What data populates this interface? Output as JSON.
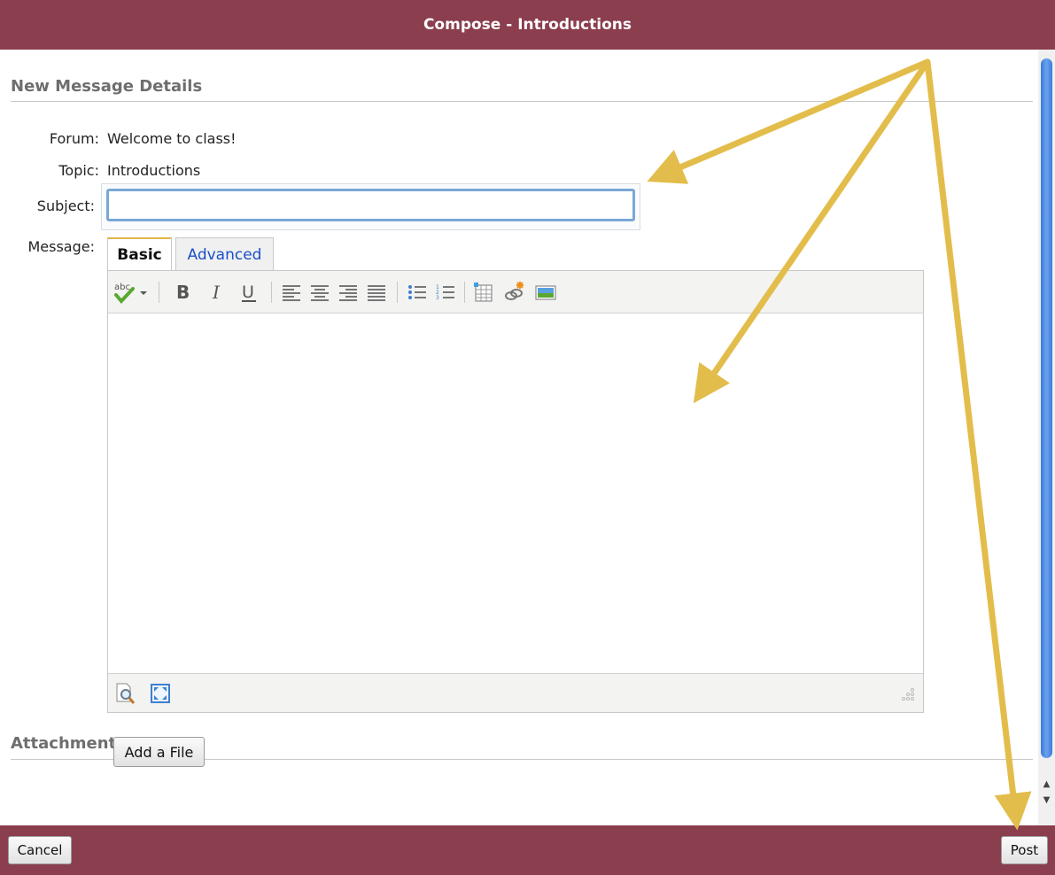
{
  "window": {
    "title": "Compose - Introductions"
  },
  "details": {
    "heading": "New Message Details",
    "forum_label": "Forum:",
    "forum_value": "Welcome to class!",
    "topic_label": "Topic:",
    "topic_value": "Introductions",
    "subject_label": "Subject:",
    "subject_value": "",
    "message_label": "Message:"
  },
  "editor": {
    "tabs": [
      {
        "label": "Basic",
        "active": true
      },
      {
        "label": "Advanced",
        "active": false
      }
    ],
    "toolbar_icons": [
      "spellcheck-icon",
      "bold-icon",
      "italic-icon",
      "underline-icon",
      "align-left-icon",
      "align-center-icon",
      "align-right-icon",
      "align-justify-icon",
      "bullet-list-icon",
      "numbered-list-icon",
      "table-icon",
      "link-icon",
      "image-icon"
    ],
    "status_icons": [
      "preview-icon",
      "fullscreen-icon",
      "resize-handle-icon"
    ],
    "content": ""
  },
  "attachments": {
    "heading": "Attachments",
    "add_file_label": "Add a File"
  },
  "footer": {
    "cancel_label": "Cancel",
    "post_label": "Post"
  },
  "colors": {
    "bar": "#8b3e4e",
    "annotation_arrow": "#e3bd4b",
    "link": "#1a4fc7",
    "focus": "#7aa7d8"
  }
}
